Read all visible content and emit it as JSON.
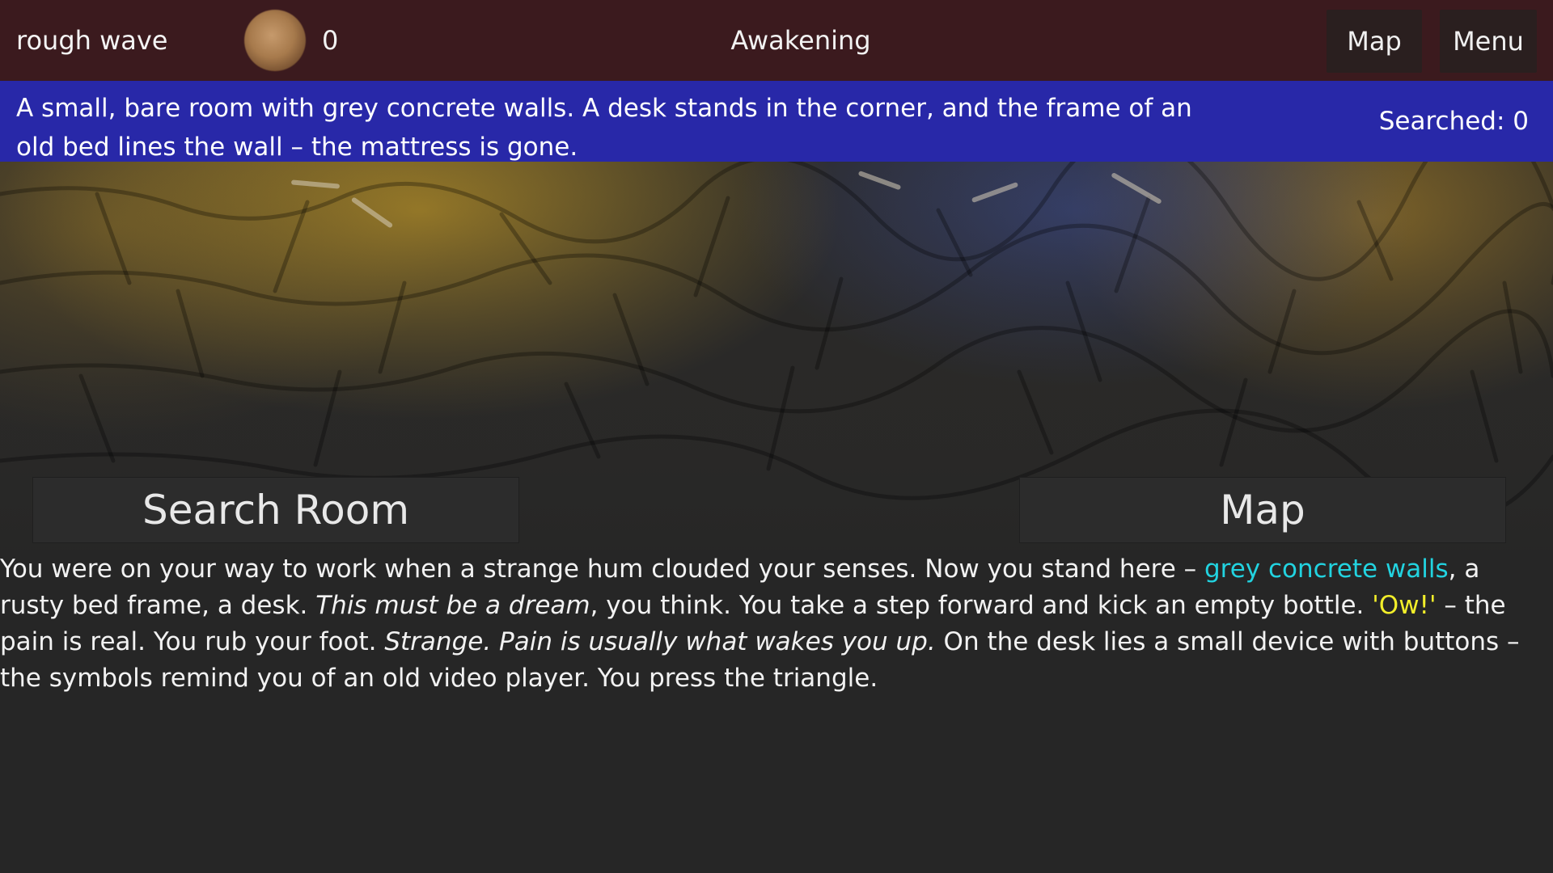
{
  "header": {
    "player_name": "rough wave",
    "coin_count": "0",
    "chapter_title": "Awakening",
    "map_label": "Map",
    "menu_label": "Menu"
  },
  "room": {
    "description": "A small, bare room with grey concrete walls. A desk stands in the corner, and the frame of an old bed lines the wall – the mattress is gone.",
    "searched_label": "Searched: 0"
  },
  "actions": {
    "search_label": "Search Room",
    "map_label": "Map"
  },
  "story": {
    "seg1": "You were on your way to work when a strange hum clouded your senses. Now you stand here – ",
    "seg2_highlight": "grey concrete walls",
    "seg3": ", a rusty bed frame, a desk. ",
    "seg4_italic": "This must be a dream",
    "seg5": ", you think. You take a step forward and kick an empty bottle. ",
    "seg6_highlight": "'Ow!'",
    "seg7": " – the pain is real. You rub your foot. ",
    "seg8_italic": "Strange. Pain is usually what wakes you up.",
    "seg9": " On the desk lies a small device with buttons – the symbols remind you of an old video player. You press the triangle."
  },
  "colors": {
    "topbar": "#3b1a1e",
    "description_band": "#2828a8",
    "highlight_cyan": "#22d3e0",
    "highlight_yellow": "#f2ee2a"
  },
  "icons": {
    "currency": "coin-icon"
  }
}
